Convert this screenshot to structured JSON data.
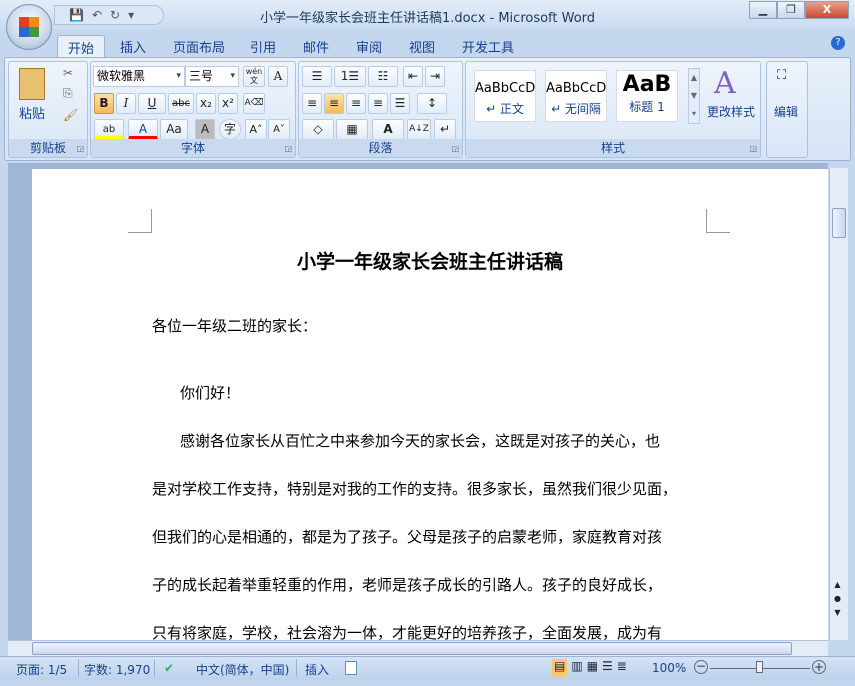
{
  "window": {
    "title": "小学一年级家长会班主任讲话稿1.docx - Microsoft Word",
    "minimize": "▁",
    "restore": "❐",
    "close": "X"
  },
  "qat": {
    "save": "💾",
    "undo": "↶",
    "redo": "↻",
    "customize": "▾"
  },
  "tabs": [
    "开始",
    "插入",
    "页面布局",
    "引用",
    "邮件",
    "审阅",
    "视图",
    "开发工具"
  ],
  "help": "?",
  "ribbon": {
    "clipboard": {
      "label": "剪贴板",
      "paste": "粘贴",
      "cut": "✂",
      "copy": "⎘",
      "format_painter": "🖌"
    },
    "font": {
      "label": "字体",
      "font_name": "微软雅黑",
      "font_size": "三号",
      "phonetic": "wén文",
      "border": "A",
      "bold": "B",
      "italic": "I",
      "underline": "U",
      "strike": "abc",
      "subscript": "x₂",
      "superscript": "x²",
      "clear": "A⌫",
      "highlight": "ab",
      "font_color": "A",
      "case": "Aa",
      "shade": "A",
      "enclose": "字",
      "grow": "A˄",
      "shrink": "A˅",
      "highlight_color": "#ffff00",
      "font_color_value": "#ff0000"
    },
    "paragraph": {
      "label": "段落",
      "bullets": "☰",
      "numbering": "1☰",
      "multilevel": "☷",
      "dec_indent": "⇤",
      "inc_indent": "⇥",
      "align_left": "≡",
      "center": "≡",
      "align_right": "≡",
      "justify": "≡",
      "distribute": "☰",
      "line_spacing": "↕",
      "shading": "◇",
      "borders": "▦",
      "asian": "A",
      "sort": "A↓Z",
      "marks": "↵"
    },
    "styles": {
      "label": "样式",
      "items": [
        {
          "preview": "AaBbCcD",
          "name": "↵ 正文"
        },
        {
          "preview": "AaBbCcD",
          "name": "↵ 无间隔"
        },
        {
          "preview": "AaB",
          "name": "标题 1"
        }
      ],
      "change": "更改样式"
    },
    "editing": {
      "label": "编辑"
    }
  },
  "document": {
    "title": "小学一年级家长会班主任讲话稿",
    "lines": [
      "各位一年级二班的家长：",
      "你们好！",
      "感谢各位家长从百忙之中来参加今天的家长会，这既是对孩子的关心，也",
      "是对学校工作支持，特别是对我的工作的支持。很多家长，虽然我们很少见面，",
      "但我们的心是相通的，都是为了孩子。父母是孩子的启蒙老师，家庭教育对孩",
      "子的成长起着举重轻重的作用，老师是孩子成长的引路人。孩子的良好成长，",
      "只有将家庭，学校，社会溶为一体，才能更好的培养孩子，全面发展，成为有"
    ]
  },
  "status": {
    "page": "页面: 1/5",
    "words": "字数: 1,970",
    "language": "中文(简体，中国)",
    "mode": "插入",
    "zoom": "100%",
    "zoom_percent": 100
  }
}
